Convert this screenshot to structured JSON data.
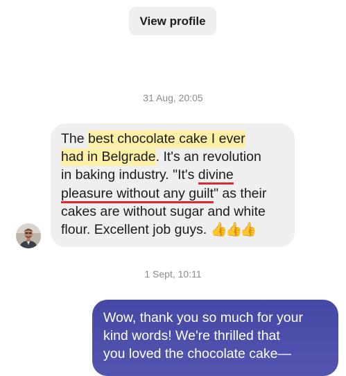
{
  "header": {
    "view_profile_label": "View profile"
  },
  "timestamps": [
    "31 Aug, 20:05",
    "1 Sept, 10:11"
  ],
  "incoming_message": {
    "line1_pre": "The ",
    "line1_hl": "best chocolate cake I ever",
    "line2_hl": "had in Belgrade",
    "line2_post": ". It's an revolution",
    "line3": "in baking industry. \"It's ",
    "line3_ul": "divine",
    "line4_ul": "pleasure without any guilt",
    "line4_post": "\" as their",
    "line5": "cakes are without sugar and white",
    "line6": "flour. Excellent job guys. ",
    "thumbs": "👍👍👍"
  },
  "outgoing_message": {
    "lines": [
      "Wow, thank you so much for your",
      "kind words! We're thrilled that",
      "you loved the chocolate cake—"
    ]
  },
  "colors": {
    "highlight": "#fbf0a6",
    "underline": "#e0262e",
    "incoming_bubble": "#efefef",
    "outgoing_bubble": "#4c4da6"
  }
}
